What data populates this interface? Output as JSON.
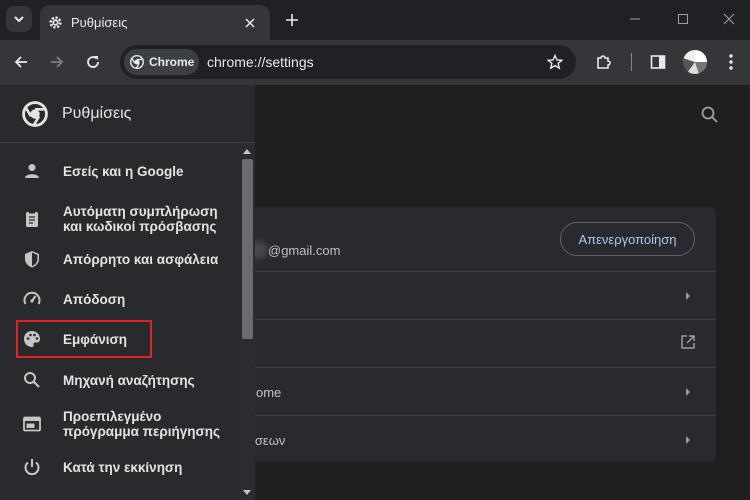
{
  "tab": {
    "title": "Ρυθμίσεις"
  },
  "omnibox": {
    "chip_label": "Chrome",
    "url": "chrome://settings"
  },
  "drawer": {
    "title": "Ρυθμίσεις",
    "items": [
      {
        "name": "you-and-google",
        "icon": "person-icon",
        "label": "Εσείς και η Google"
      },
      {
        "name": "autofill",
        "icon": "clipboard-icon",
        "label": "Αυτόματη συμπλήρωση\nκαι κωδικοί πρόσβασης"
      },
      {
        "name": "privacy",
        "icon": "shield-icon",
        "label": "Απόρρητο και ασφάλεια"
      },
      {
        "name": "performance",
        "icon": "gauge-icon",
        "label": "Απόδοση"
      },
      {
        "name": "appearance",
        "icon": "palette-icon",
        "label": "Εμφάνιση",
        "highlighted": true
      },
      {
        "name": "search-engine",
        "icon": "search-icon",
        "label": "Μηχανή αναζήτησης"
      },
      {
        "name": "default-browser",
        "icon": "browser-window-icon",
        "label": "Προεπιλεγμένο\nπρόγραμμα περιήγησης"
      },
      {
        "name": "on-startup",
        "icon": "power-icon",
        "label": "Κατά την εκκίνηση"
      }
    ]
  },
  "main": {
    "email_suffix": "@gmail.com",
    "signout_label": "Απενεργοποίηση",
    "row_partial_1": "ome",
    "row_partial_2": "ίσεων"
  },
  "colors": {
    "highlight": "#e02424",
    "accent": "#a8c7fa"
  }
}
